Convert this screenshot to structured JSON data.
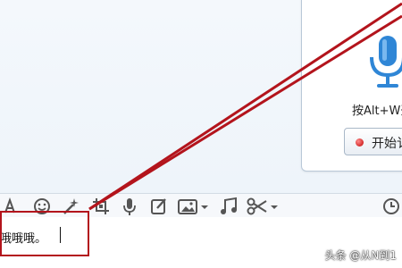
{
  "voice_panel": {
    "hotkey_text": "按Alt+W开",
    "start_button_label": "开始讠",
    "mic_icon": "microphone-icon"
  },
  "toolbar": {
    "icons": [
      "font-icon",
      "emoji-icon",
      "magic-icon",
      "screenshot-icon",
      "voice-icon",
      "edit-icon",
      "image-icon",
      "music-icon",
      "scissors-icon",
      "history-icon"
    ]
  },
  "input": {
    "text": "哦哦哦。"
  },
  "colors": {
    "annotation_red": "#b3141c",
    "mic_blue": "#2f86d6"
  },
  "watermark": {
    "text": "头条 @从N到1"
  }
}
